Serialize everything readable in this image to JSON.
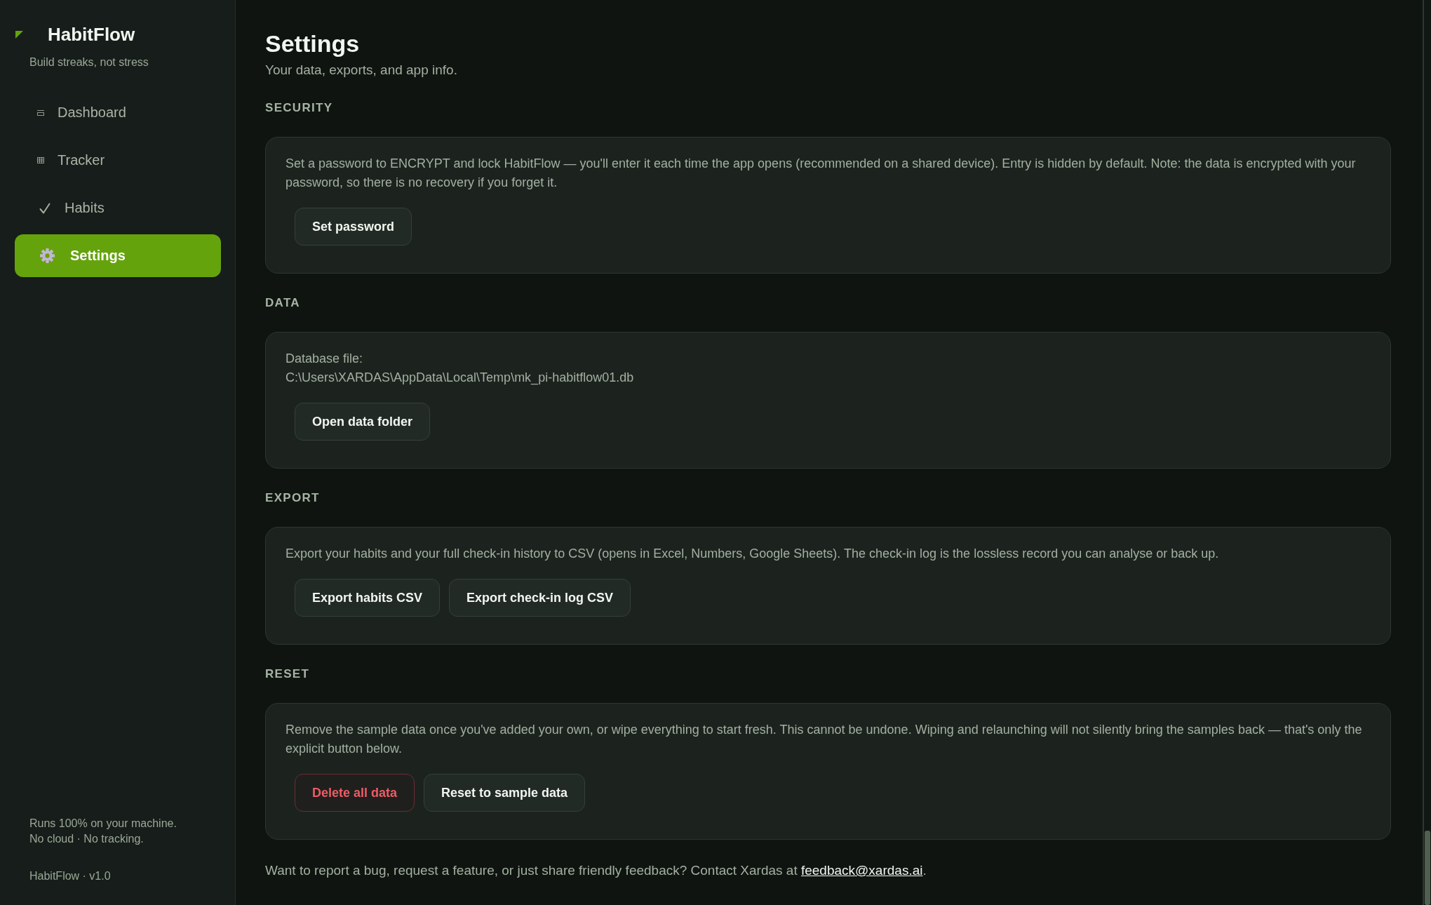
{
  "sidebar": {
    "brand": {
      "name": "HabitFlow",
      "tagline": "Build streaks, not stress"
    },
    "nav": [
      {
        "label": "Dashboard",
        "selected": false
      },
      {
        "label": "Tracker",
        "selected": false
      },
      {
        "label": "Habits",
        "selected": false
      },
      {
        "label": "Settings",
        "selected": true
      }
    ],
    "footer_lines": [
      "Runs 100% on your machine.",
      "No cloud · No tracking."
    ],
    "version": "HabitFlow · v1.0"
  },
  "page": {
    "title": "Settings",
    "subtitle": "Your data, exports, and app info."
  },
  "sections": [
    {
      "heading": "SECURITY",
      "description": "Set a password to ENCRYPT and lock HabitFlow — you'll enter it each time the app opens (recommended on a shared device). Entry is hidden by default. Note: the data is encrypted with your password, so there is no recovery if you forget it.",
      "buttons": [
        {
          "label": "Set password",
          "kind": "default"
        }
      ]
    },
    {
      "heading": "DATA",
      "field": {
        "label": "Database file:",
        "value": "C:\\Users\\XARDAS\\AppData\\Local\\Temp\\mk_pi-habitflow01.db"
      },
      "buttons": [
        {
          "label": "Open data folder",
          "kind": "default"
        }
      ]
    },
    {
      "heading": "EXPORT",
      "description": "Export your habits and your full check-in history to CSV (opens in Excel, Numbers, Google Sheets). The check-in log is the lossless record you can analyse or back up.",
      "buttons": [
        {
          "label": "Export habits CSV",
          "kind": "default"
        },
        {
          "label": "Export check-in log CSV",
          "kind": "default"
        }
      ]
    },
    {
      "heading": "RESET",
      "description": "Remove the sample data once you've added your own, or wipe everything to start fresh. This cannot be undone. Wiping and relaunching will not silently bring the samples back — that's only the explicit button below.",
      "buttons": [
        {
          "label": "Delete all data",
          "kind": "danger"
        },
        {
          "label": "Reset to sample data",
          "kind": "default"
        }
      ]
    }
  ],
  "contact": {
    "text": "Want to report a bug, request a feature, or just share friendly feedback? Contact Xardas at",
    "link": "feedback@xardas.ai",
    "end": "."
  }
}
